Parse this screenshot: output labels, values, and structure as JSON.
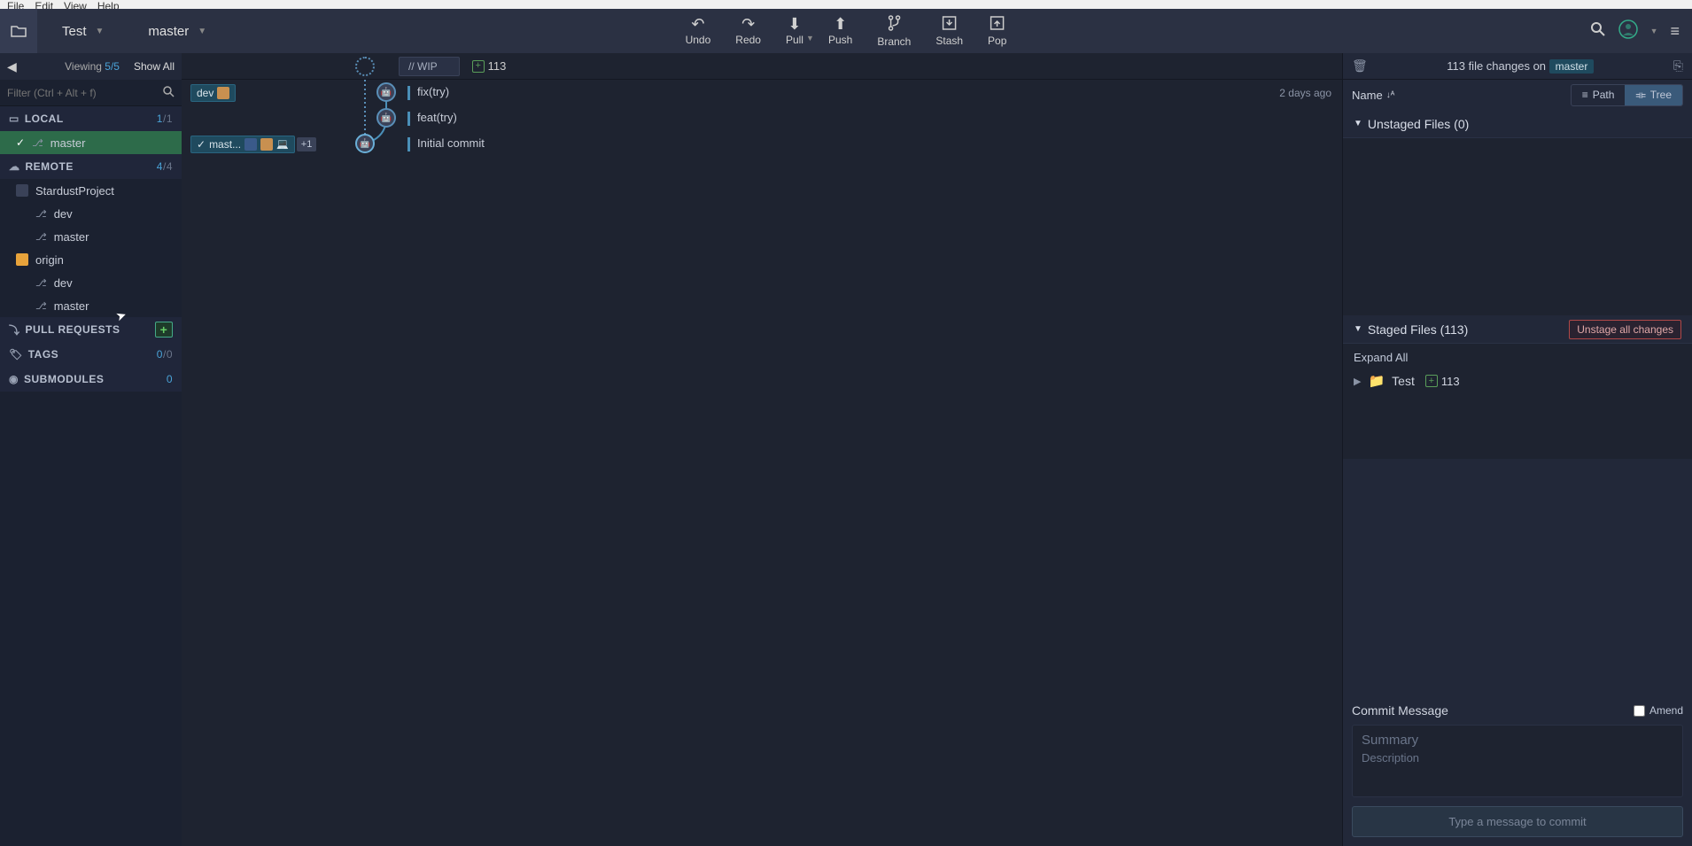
{
  "menubar": [
    "File",
    "Edit",
    "View",
    "Help"
  ],
  "topbar": {
    "repo": "Test",
    "branch": "master",
    "buttons": {
      "undo": "Undo",
      "redo": "Redo",
      "pull": "Pull",
      "push": "Push",
      "branch": "Branch",
      "stash": "Stash",
      "pop": "Pop"
    }
  },
  "sidebar": {
    "viewing_label": "Viewing",
    "viewing_count": "5/5",
    "show_all": "Show All",
    "filter_placeholder": "Filter (Ctrl + Alt + f)",
    "sections": {
      "local": {
        "title": "LOCAL",
        "count_a": "1",
        "count_b": "/1",
        "items": [
          "master"
        ]
      },
      "remote": {
        "title": "REMOTE",
        "count_a": "4",
        "count_b": "/4",
        "remotes": [
          {
            "name": "StardustProject",
            "branches": [
              "dev",
              "master"
            ]
          },
          {
            "name": "origin",
            "branches": [
              "dev",
              "master"
            ]
          }
        ]
      },
      "pull_requests": {
        "title": "PULL REQUESTS"
      },
      "tags": {
        "title": "TAGS",
        "count_a": "0",
        "count_b": "/0"
      },
      "submodules": {
        "title": "SUBMODULES",
        "count": "0"
      }
    }
  },
  "center": {
    "wip_label": "// WIP",
    "wip_count": "113",
    "commits": [
      {
        "branch_label": "dev",
        "message": "fix(try)",
        "time": "2 days ago"
      },
      {
        "message": "feat(try)"
      },
      {
        "branch_label": "mast...",
        "extra_count": "+1",
        "message": "Initial commit"
      }
    ]
  },
  "right": {
    "changes_prefix": "113 file changes on",
    "changes_branch": "master",
    "name_label": "Name",
    "path_btn": "Path",
    "tree_btn": "Tree",
    "unstaged_title": "Unstaged Files (0)",
    "staged_title": "Staged Files (113)",
    "unstage_all": "Unstage all changes",
    "expand_all": "Expand All",
    "tree_root": "Test",
    "tree_root_count": "113",
    "commit_message_title": "Commit Message",
    "amend_label": "Amend",
    "summary_placeholder": "Summary",
    "description_placeholder": "Description",
    "commit_btn": "Type a message to commit"
  }
}
